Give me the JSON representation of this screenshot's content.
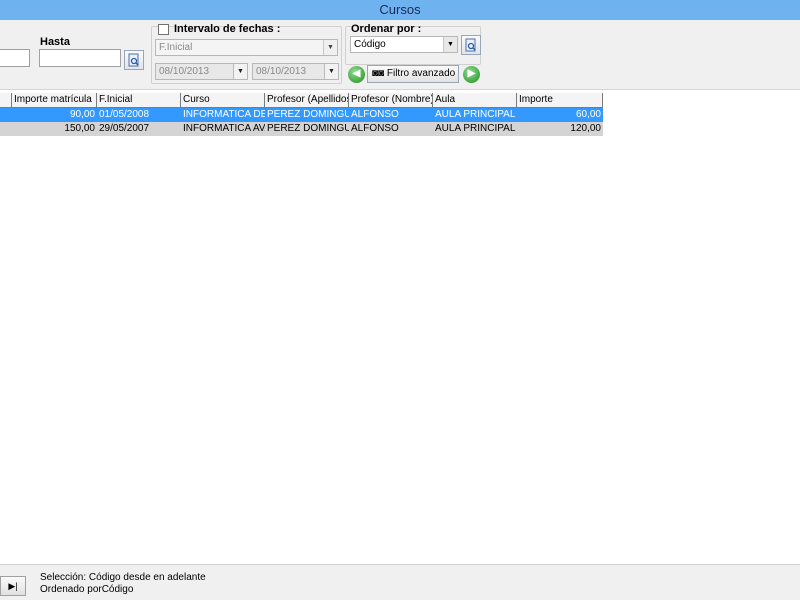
{
  "window": {
    "title": "Cursos"
  },
  "filters": {
    "hasta_label": "Hasta",
    "intervalo_label": "Intervalo de fechas :",
    "date_field_value": "F.Inicial",
    "date_from": "08/10/2013",
    "date_to": "08/10/2013",
    "ordenar_label": "Ordenar por :",
    "ordenar_value": "Código",
    "filtro_avanzado_label": "Filtro avanzado"
  },
  "grid": {
    "columns": [
      "Importe matrícula",
      "F.Inicial",
      "Curso",
      "Profesor (Apellidos)",
      "Profesor (Nombre)",
      "Aula",
      "Importe"
    ],
    "rows": [
      {
        "importe_matricula": "90,00",
        "f_inicial": "01/05/2008",
        "curso": "INFORMATICA DE (",
        "prof_apellidos": "PEREZ DOMINGUE",
        "prof_nombre": "ALFONSO",
        "aula": "AULA PRINCIPAL",
        "importe": "60,00"
      },
      {
        "importe_matricula": "150,00",
        "f_inicial": "29/05/2007",
        "curso": "INFORMATICA AVA",
        "prof_apellidos": "PEREZ DOMINGUE",
        "prof_nombre": "ALFONSO",
        "aula": "AULA PRINCIPAL",
        "importe": "120,00"
      }
    ]
  },
  "status": {
    "line1": "Selección: Código desde  en adelante",
    "line2": "Ordenado porCódigo",
    "nav_glyph": "▶|"
  },
  "colors": {
    "titlebar": "#6fb2f0",
    "selected_row": "#3399ff",
    "normal_row": "#d4d4d4"
  },
  "icons": {
    "filter_button": "search-doc-icon",
    "nav_prev": "arrow-left-circle-icon",
    "nav_next": "arrow-right-circle-icon",
    "binoculars": "binoculars-icon"
  }
}
